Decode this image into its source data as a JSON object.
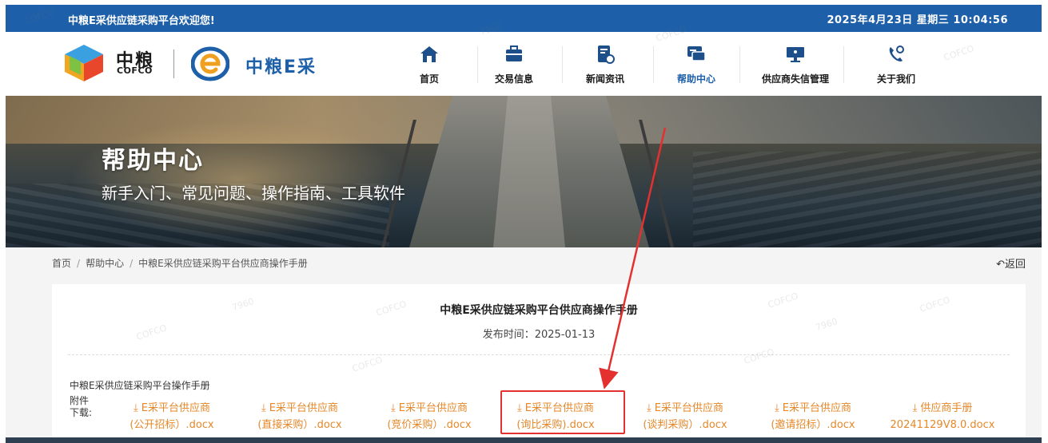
{
  "topbar": {
    "welcome": "中粮E采供应链采购平台欢迎您!",
    "datetime": "2025年4月23日 星期三 10:04:56"
  },
  "header": {
    "brand_cn": "中粮",
    "brand_en": "COFCO",
    "platform_name": "中粮E采",
    "nav": [
      {
        "label": "首页",
        "icon": "home-icon"
      },
      {
        "label": "交易信息",
        "icon": "briefcase-icon"
      },
      {
        "label": "新闻资讯",
        "icon": "news-icon"
      },
      {
        "label": "帮助中心",
        "icon": "chat-icon",
        "active": true
      },
      {
        "label": "供应商失信管理",
        "icon": "monitor-icon"
      },
      {
        "label": "关于我们",
        "icon": "phone-icon"
      }
    ]
  },
  "banner": {
    "title": "帮助中心",
    "subtitle": "新手入门、常见问题、操作指南、工具软件"
  },
  "breadcrumb": {
    "items": [
      "首页",
      "帮助中心",
      "中粮E采供应链采购平台供应商操作手册"
    ],
    "back_label": "返回"
  },
  "article": {
    "title": "中粮E采供应链采购平台供应商操作手册",
    "publish_label": "发布时间：",
    "publish_date": "2025-01-13",
    "doc_name": "中粮E采供应链采购平台操作手册",
    "attachment_label": "附件下载:",
    "files": [
      {
        "line1": "E采平台供应商",
        "line2": "(公开招标）.docx"
      },
      {
        "line1": "E采平台供应商",
        "line2": "(直接采购）.docx"
      },
      {
        "line1": "E采平台供应商",
        "line2": "(竞价采购）.docx"
      },
      {
        "line1": "E采平台供应商",
        "line2": "(询比采购).docx",
        "highlighted": true
      },
      {
        "line1": "E采平台供应商",
        "line2": "(谈判采购）.docx"
      },
      {
        "line1": "E采平台供应商",
        "line2": "(邀请招标）.docx"
      },
      {
        "line1": "供应商手册",
        "line2": "20241129V8.0.docx"
      }
    ]
  },
  "colors": {
    "brand_blue": "#1d5fa8",
    "link_orange": "#e6882a",
    "highlight_red": "#e53030"
  }
}
